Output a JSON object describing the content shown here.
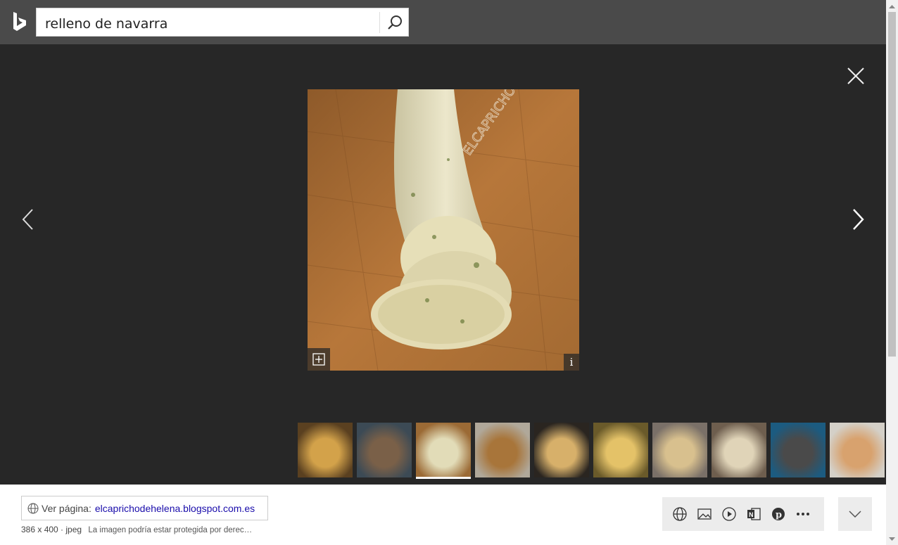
{
  "search": {
    "query": "relleno de navarra",
    "button_icon": "search-icon"
  },
  "viewer": {
    "close_icon": "close-icon",
    "prev_icon": "chevron-left-icon",
    "next_icon": "chevron-right-icon",
    "watermark": "ELCAPRICHODEHELENA",
    "info_label": "i"
  },
  "thumbnails": [
    {
      "name": "thumb-1",
      "colors": [
        "#5a4020",
        "#d3a24a"
      ]
    },
    {
      "name": "thumb-2",
      "colors": [
        "#3c4a55",
        "#7a6048"
      ]
    },
    {
      "name": "thumb-3",
      "colors": [
        "#9b6a35",
        "#e2dcb8"
      ],
      "selected": true
    },
    {
      "name": "thumb-4",
      "colors": [
        "#b0a89a",
        "#a8753a"
      ]
    },
    {
      "name": "thumb-5",
      "colors": [
        "#2a2520",
        "#d7b06a"
      ]
    },
    {
      "name": "thumb-6",
      "colors": [
        "#6a5a2a",
        "#e4c268"
      ]
    },
    {
      "name": "thumb-7",
      "colors": [
        "#7a7068",
        "#d8c08e"
      ]
    },
    {
      "name": "thumb-8",
      "colors": [
        "#6e5e4e",
        "#e0d4b8"
      ]
    },
    {
      "name": "thumb-9",
      "colors": [
        "#1c5b80",
        "#4a4a4a"
      ]
    },
    {
      "name": "thumb-10",
      "colors": [
        "#d4d0c8",
        "#d8a26e"
      ]
    }
  ],
  "details": {
    "ver_label": "Ver página:",
    "ver_link": "elcaprichodehelena.blogspot.com.es",
    "dims": "386 x 400 · jpeg",
    "copyright": "La imagen podría estar protegida por derec…"
  },
  "actions": [
    "globe-icon",
    "image-icon",
    "play-icon",
    "onenote-icon",
    "pinterest-icon",
    "more-icon"
  ],
  "colors": {
    "topbar": "#4a4a4a",
    "viewer": "#272727",
    "link": "#1a0dab"
  }
}
